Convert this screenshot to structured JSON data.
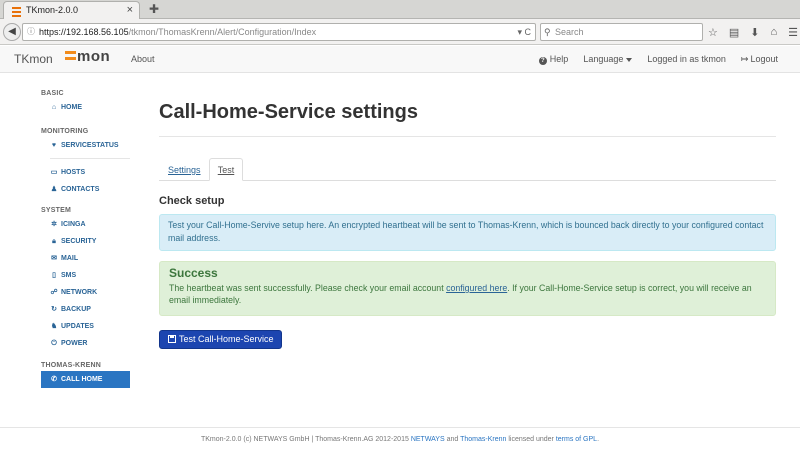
{
  "browser": {
    "tab_title": "TKmon-2.0.0",
    "tab_close": "×",
    "new_tab": "✚",
    "back_icon": "◀",
    "url_host": "https://192.168.56.105",
    "url_path": "/tkmon/ThomasKrenn/Alert/Configuration/Index",
    "url_tools": "▾ C",
    "search_placeholder": "Search",
    "nav_icons": [
      "☆",
      "▤",
      "⬇",
      "⌂",
      "☰"
    ]
  },
  "navbar": {
    "brand": "TKmon",
    "logo_text": "mon",
    "about": "About",
    "help": "Help",
    "help_icon": "?",
    "language": "Language",
    "logged_in": "Logged in as tkmon",
    "logout": "Logout",
    "logout_icon": "↦"
  },
  "sidebar": {
    "basic_heading": "BASIC",
    "home": "HOME",
    "monitoring_heading": "MONITORING",
    "servicestatus": "SERVICESTATUS",
    "hosts": "HOSTS",
    "contacts": "CONTACTS",
    "system_heading": "SYSTEM",
    "icinga": "ICINGA",
    "security": "SECURITY",
    "mail": "MAIL",
    "sms": "SMS",
    "network": "NETWORK",
    "backup": "BACKUP",
    "updates": "UPDATES",
    "power": "POWER",
    "tk_heading": "THOMAS-KRENN",
    "callhome": "CALL HOME",
    "icons": {
      "home": "⌂",
      "servicestatus": "♥",
      "hosts": "▭",
      "contacts": "♟",
      "icinga": "✲",
      "security": "🔒︎",
      "mail": "✉",
      "sms": "▯",
      "network": "☍",
      "backup": "↻",
      "updates": "♞",
      "power": "⏻",
      "callhome": "✆"
    }
  },
  "main": {
    "title": "Call-Home-Service settings",
    "tab_settings": "Settings",
    "tab_test": "Test",
    "check_heading": "Check setup",
    "info_text": "Test your Call-Home-Servive setup here. An encrypted heartbeat will be sent to Thomas-Krenn, which is bounced back directly to your configured contact mail address.",
    "success_heading": "Success",
    "success_text_1": "The heartbeat was sent successfully. Please check your email account ",
    "success_link": "configured here",
    "success_text_2": ". If your Call-Home-Service setup is correct, you will receive an email immediately.",
    "test_button": "Test Call-Home-Service"
  },
  "footer": {
    "text_1": "TKmon-2.0.0 (c) NETWAYS GmbH | Thomas-Krenn.AG 2012-2015 ",
    "netways": "NETWAYS",
    "and": " and ",
    "thomas_krenn": "Thomas-Krenn",
    "licensed": " licensed under ",
    "terms": "terms of GPL",
    "end": "."
  },
  "colors": {
    "accent": "#2a75c2",
    "button": "#1c45b0",
    "logo_orange": "#f28c1c",
    "info_bg": "#d9edf7",
    "success_bg": "#dff0d8"
  }
}
